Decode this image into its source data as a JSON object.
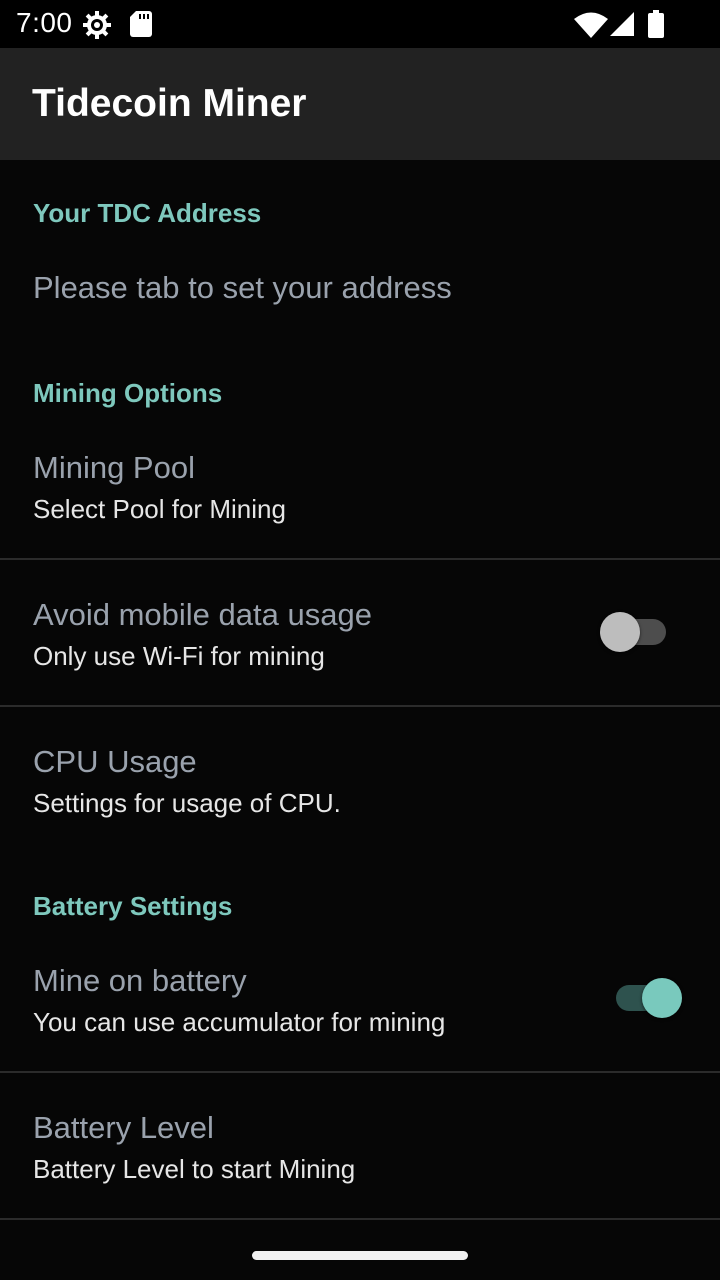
{
  "status_bar": {
    "time": "7:00",
    "icons": [
      "settings-gear-icon",
      "sd-card-icon",
      "wifi-icon",
      "cell-signal-icon",
      "battery-icon"
    ]
  },
  "app_bar": {
    "title": "Tidecoin Miner"
  },
  "sections": {
    "address": {
      "header": "Your TDC Address",
      "item_title": "Please tab to set your address"
    },
    "mining": {
      "header": "Mining Options",
      "pool_title": "Mining Pool",
      "pool_summary": "Select Pool for Mining",
      "mobile_title": "Avoid mobile data usage",
      "mobile_summary": "Only use Wi-Fi for mining",
      "mobile_switch_on": false,
      "cpu_title": "CPU Usage",
      "cpu_summary": "Settings for usage of CPU."
    },
    "battery": {
      "header": "Battery Settings",
      "mine_title": "Mine on battery",
      "mine_summary": "You can use accumulator for mining",
      "mine_switch_on": true,
      "level_title": "Battery Level",
      "level_summary": "Battery Level to start Mining"
    }
  },
  "colors": {
    "accent": "#7ec8bd",
    "app_bar": "#222222",
    "background": "#060606",
    "title_text": "#9aa2ad"
  }
}
